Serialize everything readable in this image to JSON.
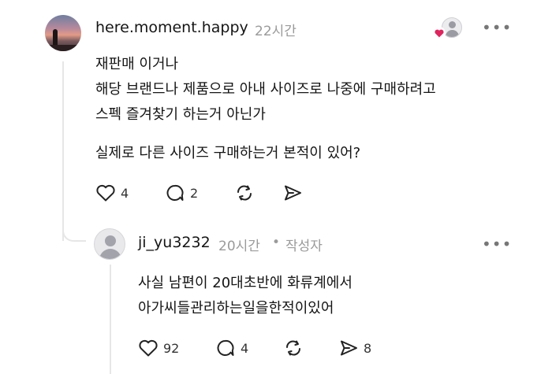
{
  "comment": {
    "username": "here.moment.happy",
    "time": "22시간",
    "lines": [
      "재판매 이거나",
      "해당 브랜드나 제품으로 아내 사이즈로 나중에 구매하려고",
      "스펙 즐겨찾기 하는거 아닌가",
      "실제로 다른 사이즈 구매하는거 본적이 있어?"
    ],
    "likes": "4",
    "replies": "2",
    "more_label": "•••",
    "avatar_icon": "profile-photo"
  },
  "reply": {
    "username": "ji_yu3232",
    "time": "20시간",
    "separator": "•",
    "author_tag": "작성자",
    "lines": [
      "사실 남편이 20대초반에 화류계에서",
      "아가씨들관리하는일을한적이있어"
    ],
    "likes": "92",
    "replies": "4",
    "shares": "8",
    "more_label": "•••",
    "avatar_icon": "default-user"
  },
  "colors": {
    "heart_badge": "#e0245e",
    "muted_text": "#9a9a9a",
    "thread_line": "#e6e6e6"
  }
}
